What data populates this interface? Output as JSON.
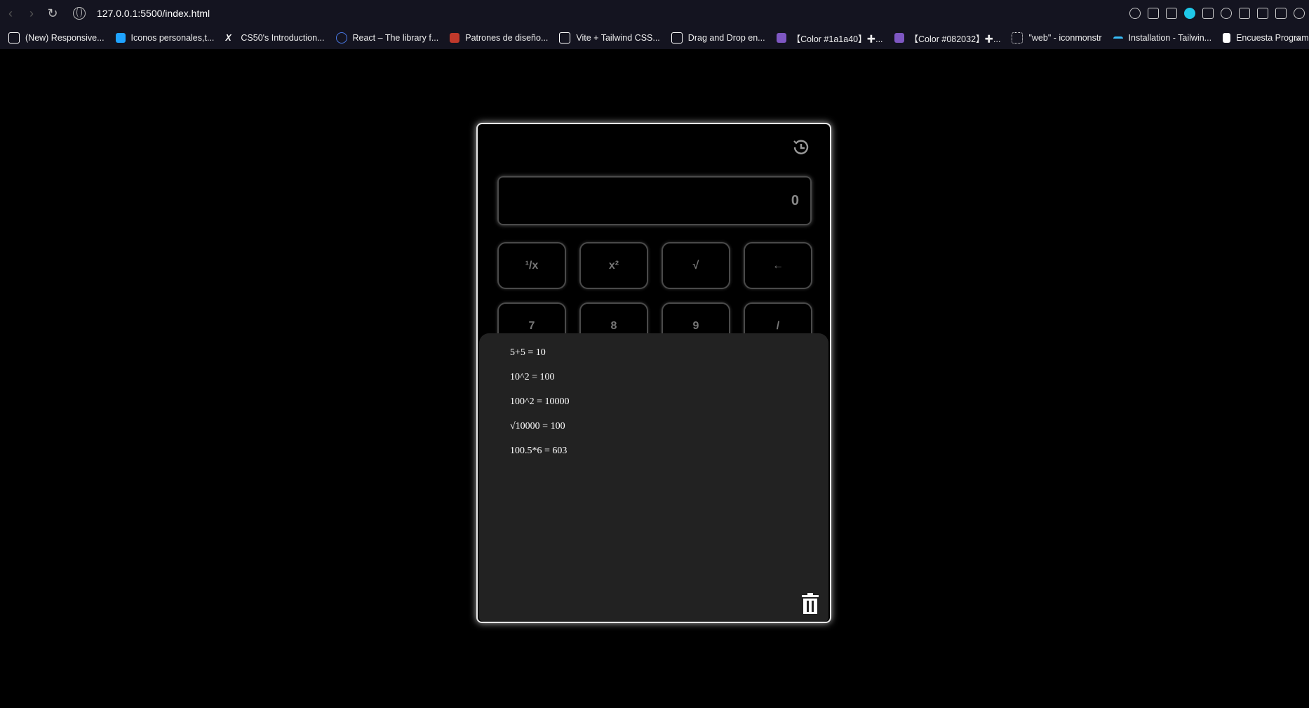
{
  "browser": {
    "url": "127.0.0.1:5500/index.html",
    "bookmarks": [
      {
        "label": "(New) Responsive...",
        "icon": "responsive-icon",
        "color": "#ffffff"
      },
      {
        "label": "Iconos personales,t...",
        "icon": "icons-icon",
        "color": "#1fa3ff"
      },
      {
        "label": "CS50's Introduction...",
        "icon": "x-icon",
        "color": "#ffffff"
      },
      {
        "label": "React – The library f...",
        "icon": "react-icon",
        "color": "#4a7ae8"
      },
      {
        "label": "Patrones de diseño...",
        "icon": "patterns-icon",
        "color": "#c0392b"
      },
      {
        "label": "Vite + Tailwind CSS...",
        "icon": "vite-icon",
        "color": "#ffffff"
      },
      {
        "label": "Drag and Drop en...",
        "icon": "dnd-icon",
        "color": "#ffffff"
      },
      {
        "label": "【Color #1a1a40】✚...",
        "icon": "color-icon",
        "color": "#7e57c2"
      },
      {
        "label": "【Color #082032】✚...",
        "icon": "color-icon",
        "color": "#7e57c2"
      },
      {
        "label": "\"web\" - iconmonstr",
        "icon": "iconmonstr-icon",
        "color": "#ffffff"
      },
      {
        "label": "Installation - Tailwin...",
        "icon": "tailwind-icon",
        "color": "#38bdf8"
      },
      {
        "label": "Encuesta Programa...",
        "icon": "document-icon",
        "color": "#ffffff"
      }
    ]
  },
  "calculator": {
    "display_value": "0",
    "keys_row1": [
      "¹/x",
      "x²",
      "√",
      "←"
    ],
    "keys_row2": [
      "7",
      "8",
      "9",
      "/"
    ]
  },
  "history": [
    "5+5 = 10",
    "10^2 = 100",
    "100^2 = 10000",
    "√10000 = 100",
    "100.5*6 = 603"
  ],
  "colors": {
    "background": "#000000",
    "panel": "#222222",
    "accent": "#1fc8e8"
  }
}
